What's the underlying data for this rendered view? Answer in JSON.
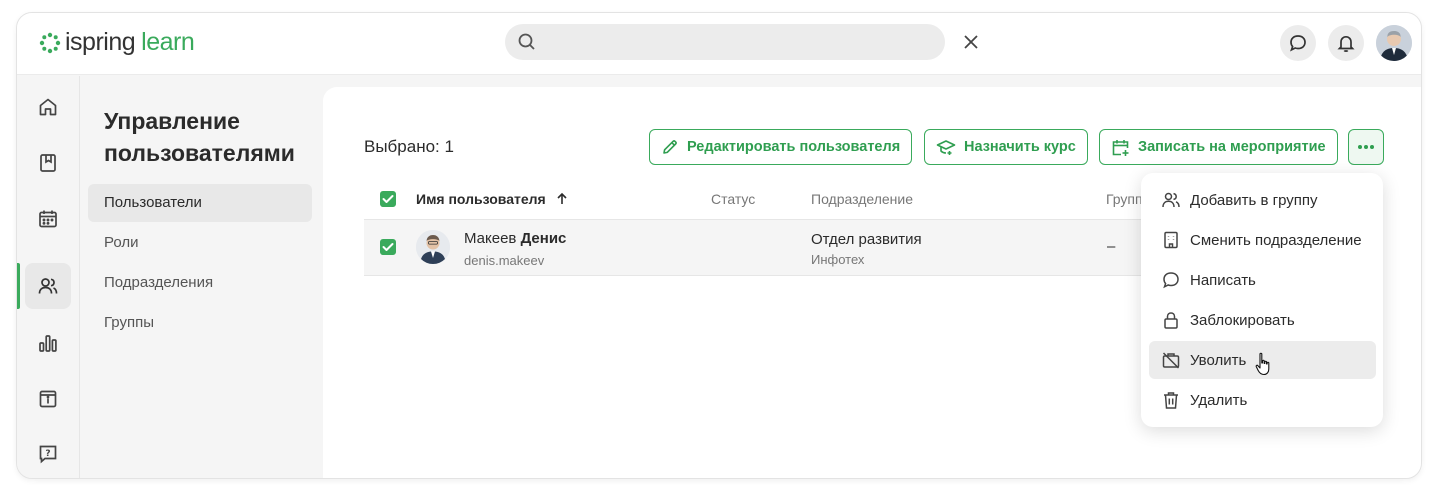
{
  "app": {
    "logo_brand": "ispring",
    "logo_product": "learn"
  },
  "search": {
    "value": "",
    "placeholder": ""
  },
  "rail": {
    "items": [
      {
        "icon": "home-icon"
      },
      {
        "icon": "book-icon"
      },
      {
        "icon": "calendar-icon"
      },
      {
        "icon": "users-icon",
        "active": true
      },
      {
        "icon": "reports-icon"
      },
      {
        "icon": "info-icon"
      },
      {
        "icon": "help-icon"
      }
    ]
  },
  "subnav": {
    "title": "Управление пользователями",
    "items": [
      {
        "label": "Пользователи",
        "active": true
      },
      {
        "label": "Роли"
      },
      {
        "label": "Подразделения"
      },
      {
        "label": "Группы"
      }
    ]
  },
  "main": {
    "selected_label": "Выбрано: 1",
    "actions": {
      "edit_user": "Редактировать пользователя",
      "assign_course": "Назначить курс",
      "enroll_event": "Записать на мероприятие"
    },
    "table": {
      "headers": {
        "name": "Имя пользователя",
        "status": "Статус",
        "department": "Подразделение",
        "groups": "Групп"
      },
      "rows": [
        {
          "last_name": "Макеев",
          "first_name": "Денис",
          "login": "denis.makeev",
          "status": "",
          "department": "Отдел развития",
          "organization": "Инфотех",
          "groups": "–"
        }
      ]
    }
  },
  "context_menu": {
    "items": [
      {
        "label": "Добавить в группу",
        "icon": "add-group-icon"
      },
      {
        "label": "Сменить подразделение",
        "icon": "change-department-icon"
      },
      {
        "label": "Написать",
        "icon": "message-icon"
      },
      {
        "label": "Заблокировать",
        "icon": "lock-icon"
      },
      {
        "label": "Уволить",
        "icon": "dismiss-icon",
        "hovered": true
      },
      {
        "label": "Удалить",
        "icon": "trash-icon"
      }
    ]
  },
  "colors": {
    "accent": "#3aaa5c",
    "accent_text": "#2f9e50",
    "menu_hover": "#ececec"
  }
}
